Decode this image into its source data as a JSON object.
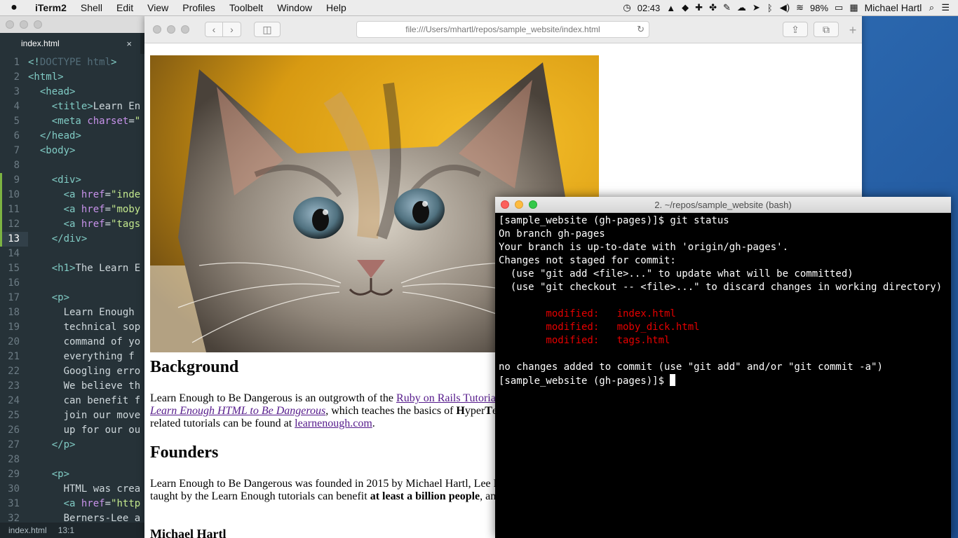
{
  "menubar": {
    "apple": "",
    "items": [
      "iTerm2",
      "Shell",
      "Edit",
      "View",
      "Profiles",
      "Toolbelt",
      "Window",
      "Help"
    ],
    "clock": "02:43",
    "battery": "98%",
    "user": "Michael Hartl"
  },
  "editor": {
    "tab_title": "index.html",
    "close": "×",
    "status_file": "index.html",
    "status_pos": "13:1",
    "lines": [
      {
        "n": "1",
        "t": "<!DOCTYPE html>"
      },
      {
        "n": "2",
        "t": "<html>"
      },
      {
        "n": "3",
        "t": "  <head>"
      },
      {
        "n": "4",
        "t": "    <title>Learn En"
      },
      {
        "n": "5",
        "t": "    <meta charset=\""
      },
      {
        "n": "6",
        "t": "  </head>"
      },
      {
        "n": "7",
        "t": "  <body>"
      },
      {
        "n": "8",
        "t": ""
      },
      {
        "n": "9",
        "t": "    <div>"
      },
      {
        "n": "10",
        "t": "      <a href=\"inde"
      },
      {
        "n": "11",
        "t": "      <a href=\"moby"
      },
      {
        "n": "12",
        "t": "      <a href=\"tags"
      },
      {
        "n": "13",
        "t": "    </div>"
      },
      {
        "n": "14",
        "t": ""
      },
      {
        "n": "15",
        "t": "    <h1>The Learn E"
      },
      {
        "n": "16",
        "t": ""
      },
      {
        "n": "17",
        "t": "    <p>"
      },
      {
        "n": "18",
        "t": "      Learn Enough"
      },
      {
        "n": "19",
        "t": "      technical sop"
      },
      {
        "n": "20",
        "t": "      command of yo"
      },
      {
        "n": "21",
        "t": "      everything f"
      },
      {
        "n": "22",
        "t": "      Googling erro"
      },
      {
        "n": "23",
        "t": "      We believe th"
      },
      {
        "n": "24",
        "t": "      can benefit f"
      },
      {
        "n": "25",
        "t": "      join our move"
      },
      {
        "n": "26",
        "t": "      up for our ou"
      },
      {
        "n": "27",
        "t": "    </p>"
      },
      {
        "n": "28",
        "t": ""
      },
      {
        "n": "29",
        "t": "    <p>"
      },
      {
        "n": "30",
        "t": "      HTML was crea"
      },
      {
        "n": "31",
        "t": "      <a href=\"http"
      },
      {
        "n": "32",
        "t": "      Berners-Lee a"
      }
    ]
  },
  "browser": {
    "url": "file:///Users/mhartl/repos/sample_website/index.html",
    "back": "‹",
    "forward": "›",
    "new_tab": "+",
    "page": {
      "h_background": "Background",
      "p1_a": "Learn Enough to Be Dangerous is an outgrowth of the ",
      "p1_link1": "Ruby on Rails Tutoria",
      "p2_link": "Learn Enough HTML to Be Dangerous",
      "p2_b": ", which teaches the basics of ",
      "p2_bold1": "H",
      "p2_c": "yper",
      "p2_bold2": "T",
      "p2_d": "e",
      "p3_a": "related tutorials can be found at ",
      "p3_link": "learnenough.com",
      "p3_b": ".",
      "h_founders": "Founders",
      "p4": "Learn Enough to Be Dangerous was founded in 2015 by Michael Hartl, Lee D",
      "p5_a": "taught by the Learn Enough tutorials can benefit ",
      "p5_bold": "at least a billion people",
      "p5_b": ", an",
      "h_michael": "Michael Hartl"
    }
  },
  "terminal": {
    "title": "2. ~/repos/sample_website (bash)",
    "lines": [
      {
        "t": "[sample_website (gh-pages)]$ git status",
        "red": false
      },
      {
        "t": "On branch gh-pages",
        "red": false
      },
      {
        "t": "Your branch is up-to-date with 'origin/gh-pages'.",
        "red": false
      },
      {
        "t": "Changes not staged for commit:",
        "red": false
      },
      {
        "t": "  (use \"git add <file>...\" to update what will be committed)",
        "red": false
      },
      {
        "t": "  (use \"git checkout -- <file>...\" to discard changes in working directory)",
        "red": false
      },
      {
        "t": "",
        "red": false
      },
      {
        "t": "        modified:   index.html",
        "red": true
      },
      {
        "t": "        modified:   moby_dick.html",
        "red": true
      },
      {
        "t": "        modified:   tags.html",
        "red": true
      },
      {
        "t": "",
        "red": false
      },
      {
        "t": "no changes added to commit (use \"git add\" and/or \"git commit -a\")",
        "red": false
      },
      {
        "t": "[sample_website (gh-pages)]$ ",
        "red": false
      }
    ]
  },
  "colors": {
    "terminal_bg": "#000000",
    "terminal_modified": "#e60000",
    "link": "#551a8b",
    "editor_bg": "#263238"
  },
  "icons": [
    "apple-icon",
    "clock-icon",
    "wifi-icon",
    "bluetooth-icon",
    "volume-icon",
    "battery-icon",
    "search-icon",
    "list-icon",
    "reload-icon",
    "share-icon",
    "tabs-icon",
    "sidebar-icon"
  ]
}
